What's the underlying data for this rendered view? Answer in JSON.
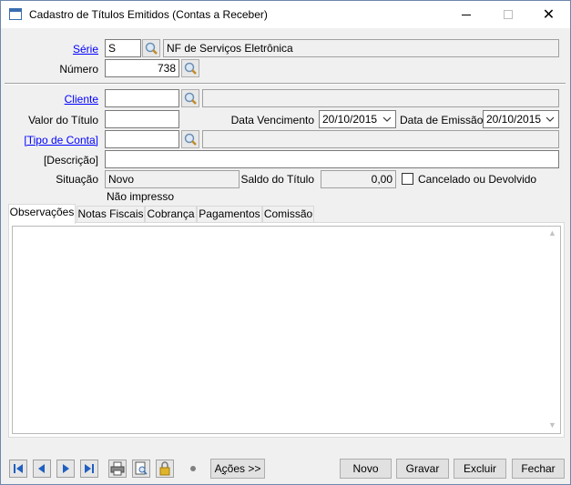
{
  "window": {
    "title": "Cadastro de Títulos Emitidos (Contas a Receber)",
    "close_glyph": "✕"
  },
  "form": {
    "serie": {
      "label": "Série",
      "value": "S",
      "description": "NF de Serviços Eletrônica"
    },
    "numero": {
      "label": "Número",
      "value": "738"
    },
    "cliente": {
      "label": "Cliente",
      "value": "",
      "description": ""
    },
    "valor_titulo": {
      "label": "Valor do Título",
      "value": ""
    },
    "data_vencimento": {
      "label": "Data Vencimento",
      "value": "20/10/2015"
    },
    "data_emissao": {
      "label": "Data de Emissão",
      "value": "20/10/2015"
    },
    "tipo_conta": {
      "label": "[Tipo de Conta]",
      "value": "",
      "description": ""
    },
    "descricao": {
      "label": "[Descrição]",
      "value": ""
    },
    "situacao": {
      "label": "Situação",
      "value": "Novo",
      "status_note": "Não impresso"
    },
    "saldo_titulo": {
      "label": "Saldo do Título",
      "value": "0,00"
    },
    "cancelado": {
      "label": "Cancelado ou Devolvido",
      "checked": false
    }
  },
  "tabs": [
    {
      "label": "Observações",
      "active": true
    },
    {
      "label": "Notas Fiscais",
      "active": false
    },
    {
      "label": "Cobrança",
      "active": false
    },
    {
      "label": "Pagamentos",
      "active": false
    },
    {
      "label": "Comissão",
      "active": false
    }
  ],
  "observacoes": {
    "text": ""
  },
  "toolbar": {
    "nav": [
      "first-record-icon",
      "previous-record-icon",
      "next-record-icon",
      "last-record-icon"
    ],
    "tools": [
      "print-icon",
      "print-preview-icon",
      "lock-icon"
    ],
    "acoes_prefix": "A",
    "acoes_underlined": "ç",
    "acoes_suffix": "ões >>",
    "novo": "Novo",
    "gravar": "Gravar",
    "excluir": "Excluir",
    "fechar": "Fechar"
  },
  "colors": {
    "window_border": "#6d87ad",
    "link": "#0000ff",
    "nav_icon": "#1f5fbf",
    "background": "#f0f0f0"
  }
}
